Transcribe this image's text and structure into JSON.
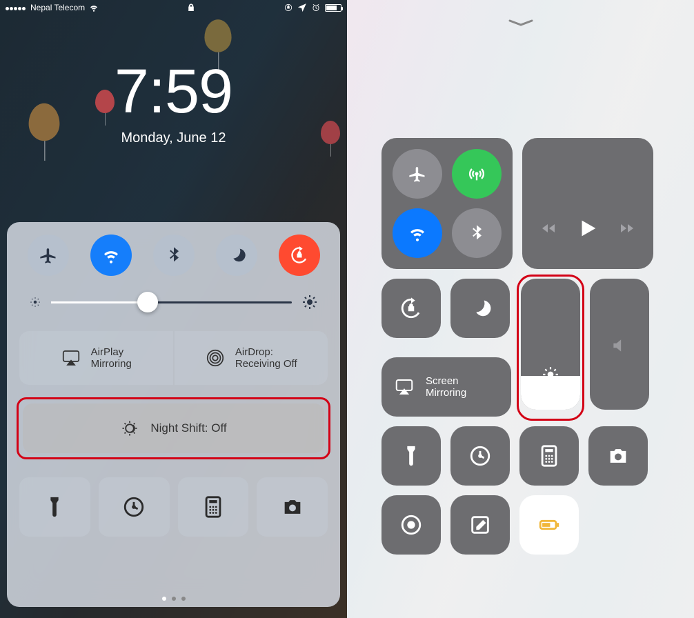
{
  "status_bar": {
    "carrier": "Nepal Telecom"
  },
  "lock_screen": {
    "time": "7:59",
    "date": "Monday, June 12"
  },
  "cc10": {
    "airplay_label": "AirPlay\nMirroring",
    "airdrop_label": "AirDrop:\nReceiving Off",
    "nightshift_label": "Night Shift: Off",
    "toggles": {
      "airplane": "off",
      "wifi": "on",
      "bluetooth": "off",
      "dnd": "off",
      "rotation_lock": "on"
    },
    "brightness_percent": 40
  },
  "cc11": {
    "mirror_label": "Screen\nMirroring",
    "brightness_percent": 26,
    "volume_percent": 0,
    "connectivity": {
      "airplane": "grey",
      "cellular": "green",
      "wifi": "blue",
      "bluetooth": "grey"
    }
  }
}
